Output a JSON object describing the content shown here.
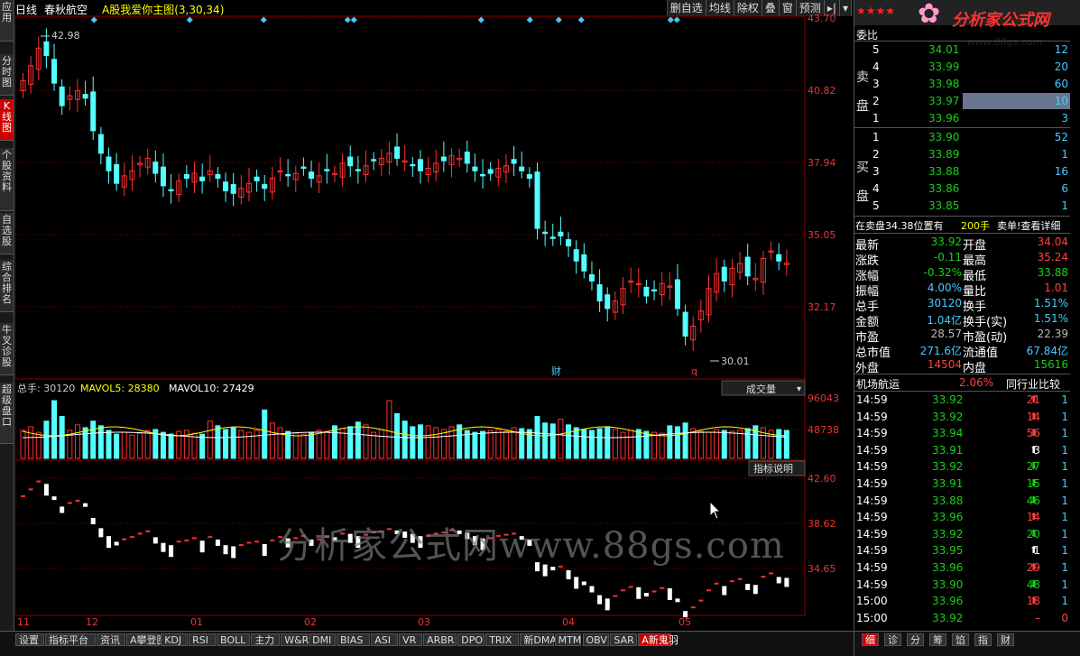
{
  "left_tabs": [
    {
      "label": "应用"
    },
    {
      "label": "分时图"
    },
    {
      "label": "K线图"
    },
    {
      "label": "个股资料"
    },
    {
      "label": "自选股"
    },
    {
      "label": "综合排名"
    },
    {
      "label": "牛叉诊股"
    },
    {
      "label": "超级盘口"
    }
  ],
  "header": {
    "period": "日线",
    "stock_name": "春秋航空",
    "indicator": "A股我爱你主图(3,30,34)",
    "buttons": [
      "删自选",
      "均线",
      "除权",
      "叠",
      "窗",
      "预测"
    ]
  },
  "price_axis": [
    "43.70",
    "40.82",
    "37.94",
    "35.05",
    "32.17"
  ],
  "high_label": "42.98",
  "low_label": "30.01",
  "event_labels": [
    "财",
    "q"
  ],
  "volume_panel": {
    "total_label": "总手: 30120",
    "mavol5": "MAVOL5: 28380",
    "mavol10": "MAVOL10: 27429",
    "dropdown": "成交量",
    "axis": [
      "96043",
      "48738"
    ]
  },
  "indicator_panel": {
    "button": "指标说明",
    "axis": [
      "42.60",
      "38.62",
      "34.65"
    ]
  },
  "watermark": "分析家公式网www.88gs.com",
  "dates": [
    "11",
    "12",
    "01",
    "02",
    "03",
    "04",
    "05"
  ],
  "bottom_tabs": [
    "设置",
    "指标平台",
    "资讯",
    "A攀登图",
    "KDJ",
    "RSI",
    "BOLL",
    "主力",
    "W&R",
    "DMI",
    "BIAS",
    "ASI",
    "VR",
    "ARBR",
    "DPO",
    "TRIX",
    "新DMA",
    "MTM",
    "OBV",
    "SAR",
    "A新鬼羽"
  ],
  "logo": {
    "text": "分析家公式网",
    "url": "www.88gs.com"
  },
  "order_book": {
    "header": "委比",
    "sell_label": "卖盘",
    "buy_label": "买盘",
    "sell": [
      {
        "level": "5",
        "price": "34.01",
        "vol": "12"
      },
      {
        "level": "4",
        "price": "33.99",
        "vol": "20"
      },
      {
        "level": "3",
        "price": "33.98",
        "vol": "60"
      },
      {
        "level": "2",
        "price": "33.97",
        "vol": "10"
      },
      {
        "level": "1",
        "price": "33.96",
        "vol": "3"
      }
    ],
    "buy": [
      {
        "level": "1",
        "price": "33.90",
        "vol": "52"
      },
      {
        "level": "2",
        "price": "33.89",
        "vol": "1"
      },
      {
        "level": "3",
        "price": "33.88",
        "vol": "16"
      },
      {
        "level": "4",
        "price": "33.86",
        "vol": "6"
      },
      {
        "level": "5",
        "price": "33.85",
        "vol": "1"
      }
    ]
  },
  "notice": {
    "text": "在卖盘34.38位置有",
    "vol": "200手",
    "action": "卖单!查看详细"
  },
  "quote": [
    {
      "l1": "最新",
      "v1": "33.92",
      "c1": "green",
      "l2": "开盘",
      "v2": "34.04",
      "c2": "red"
    },
    {
      "l1": "涨跌",
      "v1": "-0.11",
      "c1": "green",
      "l2": "最高",
      "v2": "35.24",
      "c2": "red"
    },
    {
      "l1": "涨幅",
      "v1": "-0.32%",
      "c1": "green",
      "l2": "最低",
      "v2": "33.88",
      "c2": "green"
    },
    {
      "l1": "振幅",
      "v1": "4.00%",
      "c1": "cyan",
      "l2": "量比",
      "v2": "1.01",
      "c2": "red"
    },
    {
      "l1": "总手",
      "v1": "30120",
      "c1": "cyan",
      "l2": "换手",
      "v2": "1.51%",
      "c2": "cyan"
    },
    {
      "l1": "金额",
      "v1": "1.04亿",
      "c1": "cyan",
      "l2": "换手(实)",
      "v2": "1.51%",
      "c2": "cyan"
    },
    {
      "l1": "市盈",
      "v1": "28.57",
      "c1": "gray",
      "l2": "市盈(动)",
      "v2": "22.39",
      "c2": "gray"
    },
    {
      "l1": "总市值",
      "v1": "271.6亿",
      "c1": "cyan",
      "l2": "流通值",
      "v2": "67.84亿",
      "c2": "cyan"
    },
    {
      "l1": "外盘",
      "v1": "14504",
      "c1": "red",
      "l2": "内盘",
      "v2": "15616",
      "c2": "green"
    }
  ],
  "industry": {
    "name": "机场航运",
    "change": "2.06%",
    "compare": "同行业比较"
  },
  "ticks": [
    {
      "time": "14:59",
      "price": "33.92",
      "vol": "21",
      "dir": "up",
      "n": "1"
    },
    {
      "time": "14:59",
      "price": "33.92",
      "vol": "14",
      "dir": "up",
      "n": "1"
    },
    {
      "time": "14:59",
      "price": "33.94",
      "vol": "56",
      "dir": "up",
      "n": "1"
    },
    {
      "time": "14:59",
      "price": "33.91",
      "vol": "3",
      "dir": "neutral",
      "n": "1"
    },
    {
      "time": "14:59",
      "price": "33.92",
      "vol": "27",
      "dir": "down",
      "n": "1"
    },
    {
      "time": "14:59",
      "price": "33.91",
      "vol": "15",
      "dir": "down",
      "n": "1"
    },
    {
      "time": "14:59",
      "price": "33.88",
      "vol": "46",
      "dir": "down",
      "n": "1"
    },
    {
      "time": "14:59",
      "price": "33.96",
      "vol": "14",
      "dir": "up",
      "n": "1"
    },
    {
      "time": "14:59",
      "price": "33.92",
      "vol": "20",
      "dir": "down",
      "n": "1"
    },
    {
      "time": "14:59",
      "price": "33.95",
      "vol": "1",
      "dir": "neutral",
      "n": "1"
    },
    {
      "time": "14:59",
      "price": "33.96",
      "vol": "29",
      "dir": "up",
      "n": "1"
    },
    {
      "time": "14:59",
      "price": "33.90",
      "vol": "48",
      "dir": "down",
      "n": "1"
    },
    {
      "time": "15:00",
      "price": "33.96",
      "vol": "18",
      "dir": "up",
      "n": "1"
    },
    {
      "time": "15:00",
      "price": "33.92",
      "vol": "–",
      "dir": "none",
      "n": "0"
    }
  ],
  "right_tabs": [
    "细",
    "诊",
    "分",
    "筹",
    "馅",
    "指",
    "财"
  ],
  "colors": {
    "up": "#ff3030",
    "down": "#54ffff",
    "background": "#000000",
    "grid": "#8b0000"
  }
}
